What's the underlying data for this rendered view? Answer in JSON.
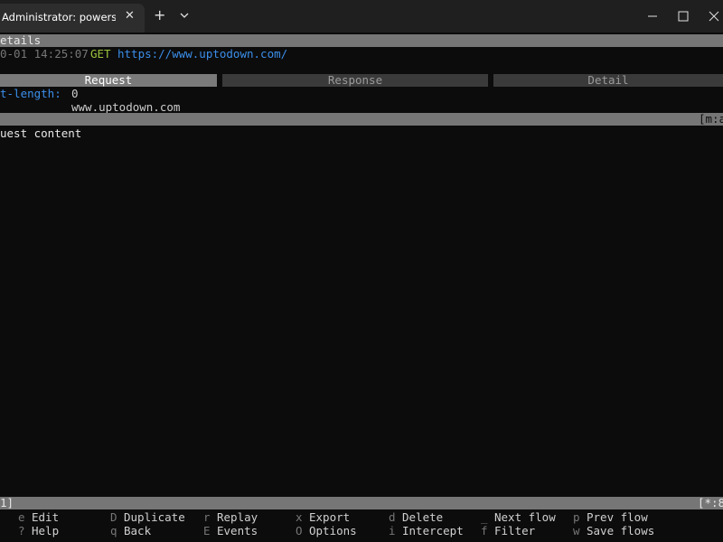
{
  "window": {
    "tab_title": "Administrator: powershell.exe",
    "close_tab": "✕",
    "new_tab": "+"
  },
  "details": {
    "header": "etails",
    "date": "0-01 14:25:07",
    "method": "GET",
    "url": "https://www.uptodown.com/"
  },
  "tabs": {
    "request": "Request",
    "response": "Response",
    "detail": "Detail"
  },
  "headers": {
    "content_length_key": "t-length:",
    "content_length_value": "0",
    "host_value": "www.uptodown.com"
  },
  "content_bar": {
    "right_indicator": "[m:a",
    "body_text": "uest content"
  },
  "status_bar": {
    "left": "1]",
    "right": "[*:8"
  },
  "help": [
    {
      "key": "e",
      "label": "Edit"
    },
    {
      "key": "D",
      "label": "Duplicate"
    },
    {
      "key": "r",
      "label": "Replay"
    },
    {
      "key": "x",
      "label": "Export"
    },
    {
      "key": "d",
      "label": "Delete"
    },
    {
      "key": "_",
      "label": "Next flow"
    },
    {
      "key": "p",
      "label": "Prev flow"
    },
    {
      "key": "?",
      "label": "Help"
    },
    {
      "key": "q",
      "label": "Back"
    },
    {
      "key": "E",
      "label": "Events"
    },
    {
      "key": "O",
      "label": "Options"
    },
    {
      "key": "i",
      "label": "Intercept"
    },
    {
      "key": "f",
      "label": "Filter"
    },
    {
      "key": "w",
      "label": "Save flows"
    }
  ],
  "colors": {
    "background": "#0c0c0c",
    "accent_blue": "#3b8eea",
    "method_green": "#9ac43b",
    "bar_gray": "#767676"
  },
  "icons": [
    "close-icon",
    "plus-icon",
    "chevron-down-icon",
    "minimize-icon",
    "maximize-icon",
    "window-close-icon"
  ]
}
